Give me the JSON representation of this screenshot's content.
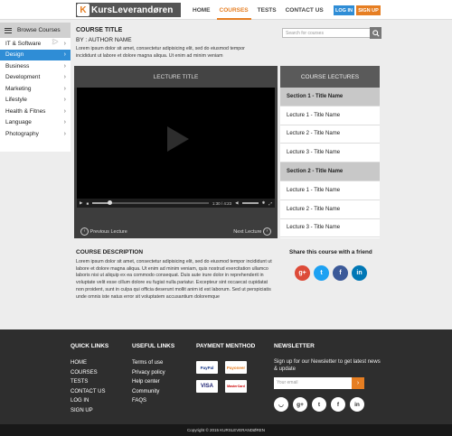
{
  "header": {
    "logo_text": "KursLeverandøren",
    "logo_mark": "K",
    "nav": [
      "HOME",
      "COURSES",
      "TESTS",
      "CONTACT US"
    ],
    "active_nav": "COURSES",
    "login_label": "LOG IN",
    "signup_label": "SIGN UP"
  },
  "sidebar": {
    "title": "Browse Courses",
    "items": [
      {
        "label": "IT & Software"
      },
      {
        "label": "Design"
      },
      {
        "label": "Business"
      },
      {
        "label": "Development"
      },
      {
        "label": "Marketing"
      },
      {
        "label": "Lifestyle"
      },
      {
        "label": "Health & Fitnes"
      },
      {
        "label": "Language"
      },
      {
        "label": "Photography"
      }
    ],
    "active_item": "Design"
  },
  "course": {
    "title": "COURSE TITLE",
    "author": "BY : AUTHOR NAME",
    "lead": "Lorem ipsum dolor sit amet, consectetur adipisicing elit, sed do eiusmod tempor incididunt ut labore et dolore magna aliqua. Ut enim ad minim veniam"
  },
  "search": {
    "placeholder": "Search for courses"
  },
  "video": {
    "header": "LECTURE TITLE",
    "time": "1:30 / 4:23",
    "progress": 0.15,
    "prev_label": "Previous Lecture",
    "next_label": "Next Lecture"
  },
  "lectures": {
    "header": "COURSE LECTURES",
    "rows": [
      {
        "label": "Section 1 - Title Name",
        "section": true
      },
      {
        "label": "Lecture 1 - Title Name",
        "section": false
      },
      {
        "label": "Lecture 2 - Title Name",
        "section": false
      },
      {
        "label": "Lecture 3 - Title Name",
        "section": false
      },
      {
        "label": "Section 2 - Title Name",
        "section": true
      },
      {
        "label": "Lecture 1 - Title Name",
        "section": false
      },
      {
        "label": "Lecture 2 - Title Name",
        "section": false
      },
      {
        "label": "Lecture 3 - Title Name",
        "section": false
      }
    ]
  },
  "description": {
    "title": "COURSE DESCRIPTION",
    "body": "Lorem ipsum dolor sit amet, consectetur adipisicing elit, sed do eiusmod tempor incididunt ut labore et dolore magna aliqua. Ut enim ad minim veniam, quis nostrud exercitation ullamco laboris nisi ut aliquip ex ea commodo consequat. Duis aute irure dolor in reprehenderit in voluptate velit esse cillum dolore eu fugiat nulla pariatur. Excepteur sint occaecat cupidatat non proident, sunt in culpa qui officia deserunt mollit anim id est laborum. Sed ut perspiciatis unde omnis iste natus error sit voluptatem accusantium doloremque"
  },
  "share": {
    "title": "Share this course with a friend",
    "icons": [
      {
        "name": "google-plus-icon",
        "glyph": "g+",
        "color": "#dd4b39"
      },
      {
        "name": "twitter-icon",
        "glyph": "t",
        "color": "#1da1f2"
      },
      {
        "name": "facebook-icon",
        "glyph": "f",
        "color": "#3b5998"
      },
      {
        "name": "linkedin-icon",
        "glyph": "in",
        "color": "#0077b5"
      }
    ]
  },
  "footer": {
    "quick_links_title": "QUICK LINKS",
    "quick_links": [
      "HOME",
      "COURSES",
      "TESTS",
      "CONTACT US",
      "LOG IN",
      "SIGN UP"
    ],
    "useful_links_title": "USEFUL LINKS",
    "useful_links": [
      "Terms of use",
      "Privacy policy",
      "Help center",
      "Community",
      "FAQS"
    ],
    "payment_title": "PAYMENT MENTHOD",
    "payment": [
      "PayPal",
      "Payoneer",
      "VISA",
      "MasterCard"
    ],
    "newsletter_title": "NEWSLETTER",
    "newsletter_text": "Sign up for our Newsletter to get latest news & update",
    "email_placeholder": "Your email",
    "social": [
      {
        "name": "rss-icon",
        "glyph": "◡"
      },
      {
        "name": "google-plus-icon",
        "glyph": "g+"
      },
      {
        "name": "twitter-icon",
        "glyph": "t"
      },
      {
        "name": "facebook-icon",
        "glyph": "f"
      },
      {
        "name": "linkedin-icon",
        "glyph": "in"
      }
    ],
    "copyright": "Copyright © 2015 KURSLEVERANDØREN"
  },
  "colors": {
    "accent": "#e67e22",
    "primary": "#2f8dd6",
    "footer_bg": "#2e2e2e"
  }
}
